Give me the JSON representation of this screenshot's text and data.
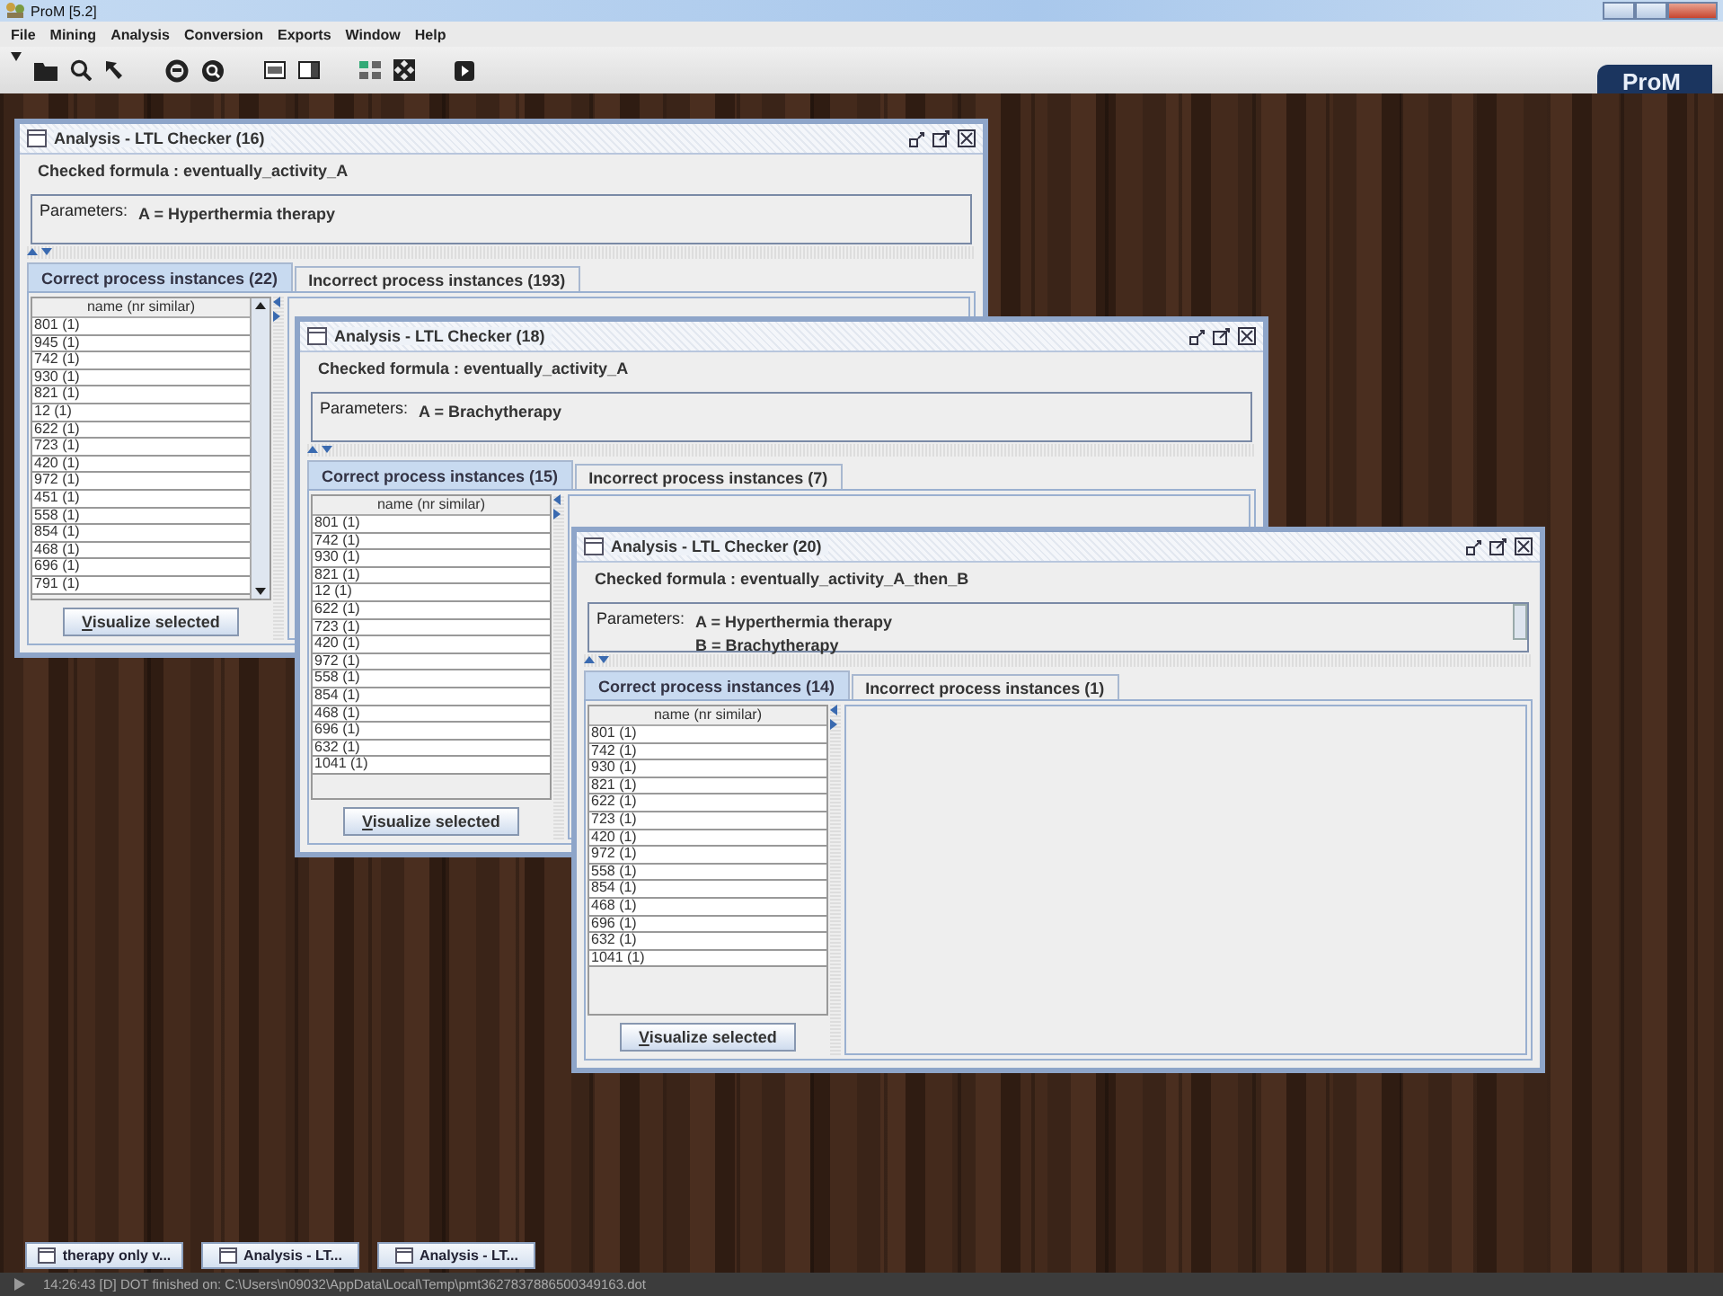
{
  "app": {
    "title": "ProM [5.2]",
    "menu": [
      "File",
      "Mining",
      "Analysis",
      "Conversion",
      "Exports",
      "Window",
      "Help"
    ],
    "logo": "ProM"
  },
  "windows": [
    {
      "title": "Analysis - LTL Checker (16)",
      "formula": "Checked formula : eventually_activity_A",
      "parameters_label": "Parameters:",
      "parameters": [
        "A = Hyperthermia therapy"
      ],
      "parameters_scrollbar": false,
      "tabs": [
        {
          "label": "Correct process instances (22)",
          "selected": true
        },
        {
          "label": "Incorrect process instances (193)",
          "selected": false
        }
      ],
      "column_header": "name (nr similar)",
      "rows": [
        "801 (1)",
        "945 (1)",
        "742 (1)",
        "930 (1)",
        "821 (1)",
        "12 (1)",
        "622 (1)",
        "723 (1)",
        "420 (1)",
        "972 (1)",
        "451 (1)",
        "558 (1)",
        "854 (1)",
        "468 (1)",
        "696 (1)",
        "791 (1)"
      ],
      "list_scrollbar": true,
      "button": "Visualize selected"
    },
    {
      "title": "Analysis - LTL Checker (18)",
      "formula": "Checked formula : eventually_activity_A",
      "parameters_label": "Parameters:",
      "parameters": [
        "A = Brachytherapy"
      ],
      "parameters_scrollbar": false,
      "tabs": [
        {
          "label": "Correct process instances (15)",
          "selected": true
        },
        {
          "label": "Incorrect process instances (7)",
          "selected": false
        }
      ],
      "column_header": "name (nr similar)",
      "rows": [
        "801 (1)",
        "742 (1)",
        "930 (1)",
        "821 (1)",
        "12 (1)",
        "622 (1)",
        "723 (1)",
        "420 (1)",
        "972 (1)",
        "558 (1)",
        "854 (1)",
        "468 (1)",
        "696 (1)",
        "632 (1)",
        "1041 (1)"
      ],
      "list_scrollbar": false,
      "button": "Visualize selected"
    },
    {
      "title": "Analysis - LTL Checker (20)",
      "formula": "Checked formula : eventually_activity_A_then_B",
      "parameters_label": "Parameters:",
      "parameters": [
        "A = Hyperthermia therapy",
        "B = Brachytherapy"
      ],
      "parameters_scrollbar": true,
      "tabs": [
        {
          "label": "Correct process instances (14)",
          "selected": true
        },
        {
          "label": "Incorrect process instances (1)",
          "selected": false
        }
      ],
      "column_header": "name (nr similar)",
      "rows": [
        "801 (1)",
        "742 (1)",
        "930 (1)",
        "821 (1)",
        "622 (1)",
        "723 (1)",
        "420 (1)",
        "972 (1)",
        "558 (1)",
        "854 (1)",
        "468 (1)",
        "696 (1)",
        "632 (1)",
        "1041 (1)"
      ],
      "list_scrollbar": false,
      "button": "Visualize selected"
    }
  ],
  "taskbar": [
    "therapy only v...",
    "Analysis - LT...",
    "Analysis - LT..."
  ],
  "status": "14:26:43 [D] DOT finished on: C:\\Users\\n09032\\AppData\\Local\\Temp\\pmt3627837886500349163.dot"
}
